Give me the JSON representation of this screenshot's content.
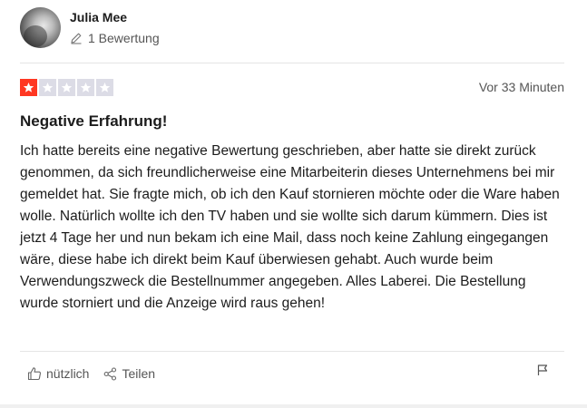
{
  "reviewer": {
    "name": "Julia Mee",
    "review_count": "1 Bewertung"
  },
  "review": {
    "rating": 1,
    "max_rating": 5,
    "timestamp": "Vor 33 Minuten",
    "title": "Negative Erfahrung!",
    "body": "Ich hatte bereits eine negative Bewertung geschrieben, aber hatte sie direkt zurück genommen, da sich freundlicherweise eine Mitarbeiterin dieses Unternehmens bei mir gemeldet hat. Sie fragte mich, ob ich den Kauf stornieren möchte oder die Ware haben wolle. Natürlich wollte ich den TV haben und sie wollte sich darum kümmern. Dies ist jetzt 4 Tage her und nun bekam ich eine Mail, dass noch keine Zahlung eingegangen wäre, diese habe ich direkt beim Kauf überwiesen gehabt. Auch wurde beim Verwendungszweck die Bestellnummer angegeben. Alles Laberei. Die Bestellung wurde storniert und die Anzeige wird raus gehen!"
  },
  "actions": {
    "useful_label": "nützlich",
    "share_label": "Teilen"
  },
  "colors": {
    "star_filled": "#ff3722",
    "star_empty": "#dcdce6"
  },
  "icons": {
    "edit": "pencil-icon",
    "like": "thumbs-up-icon",
    "share": "share-icon",
    "report": "flag-icon"
  }
}
